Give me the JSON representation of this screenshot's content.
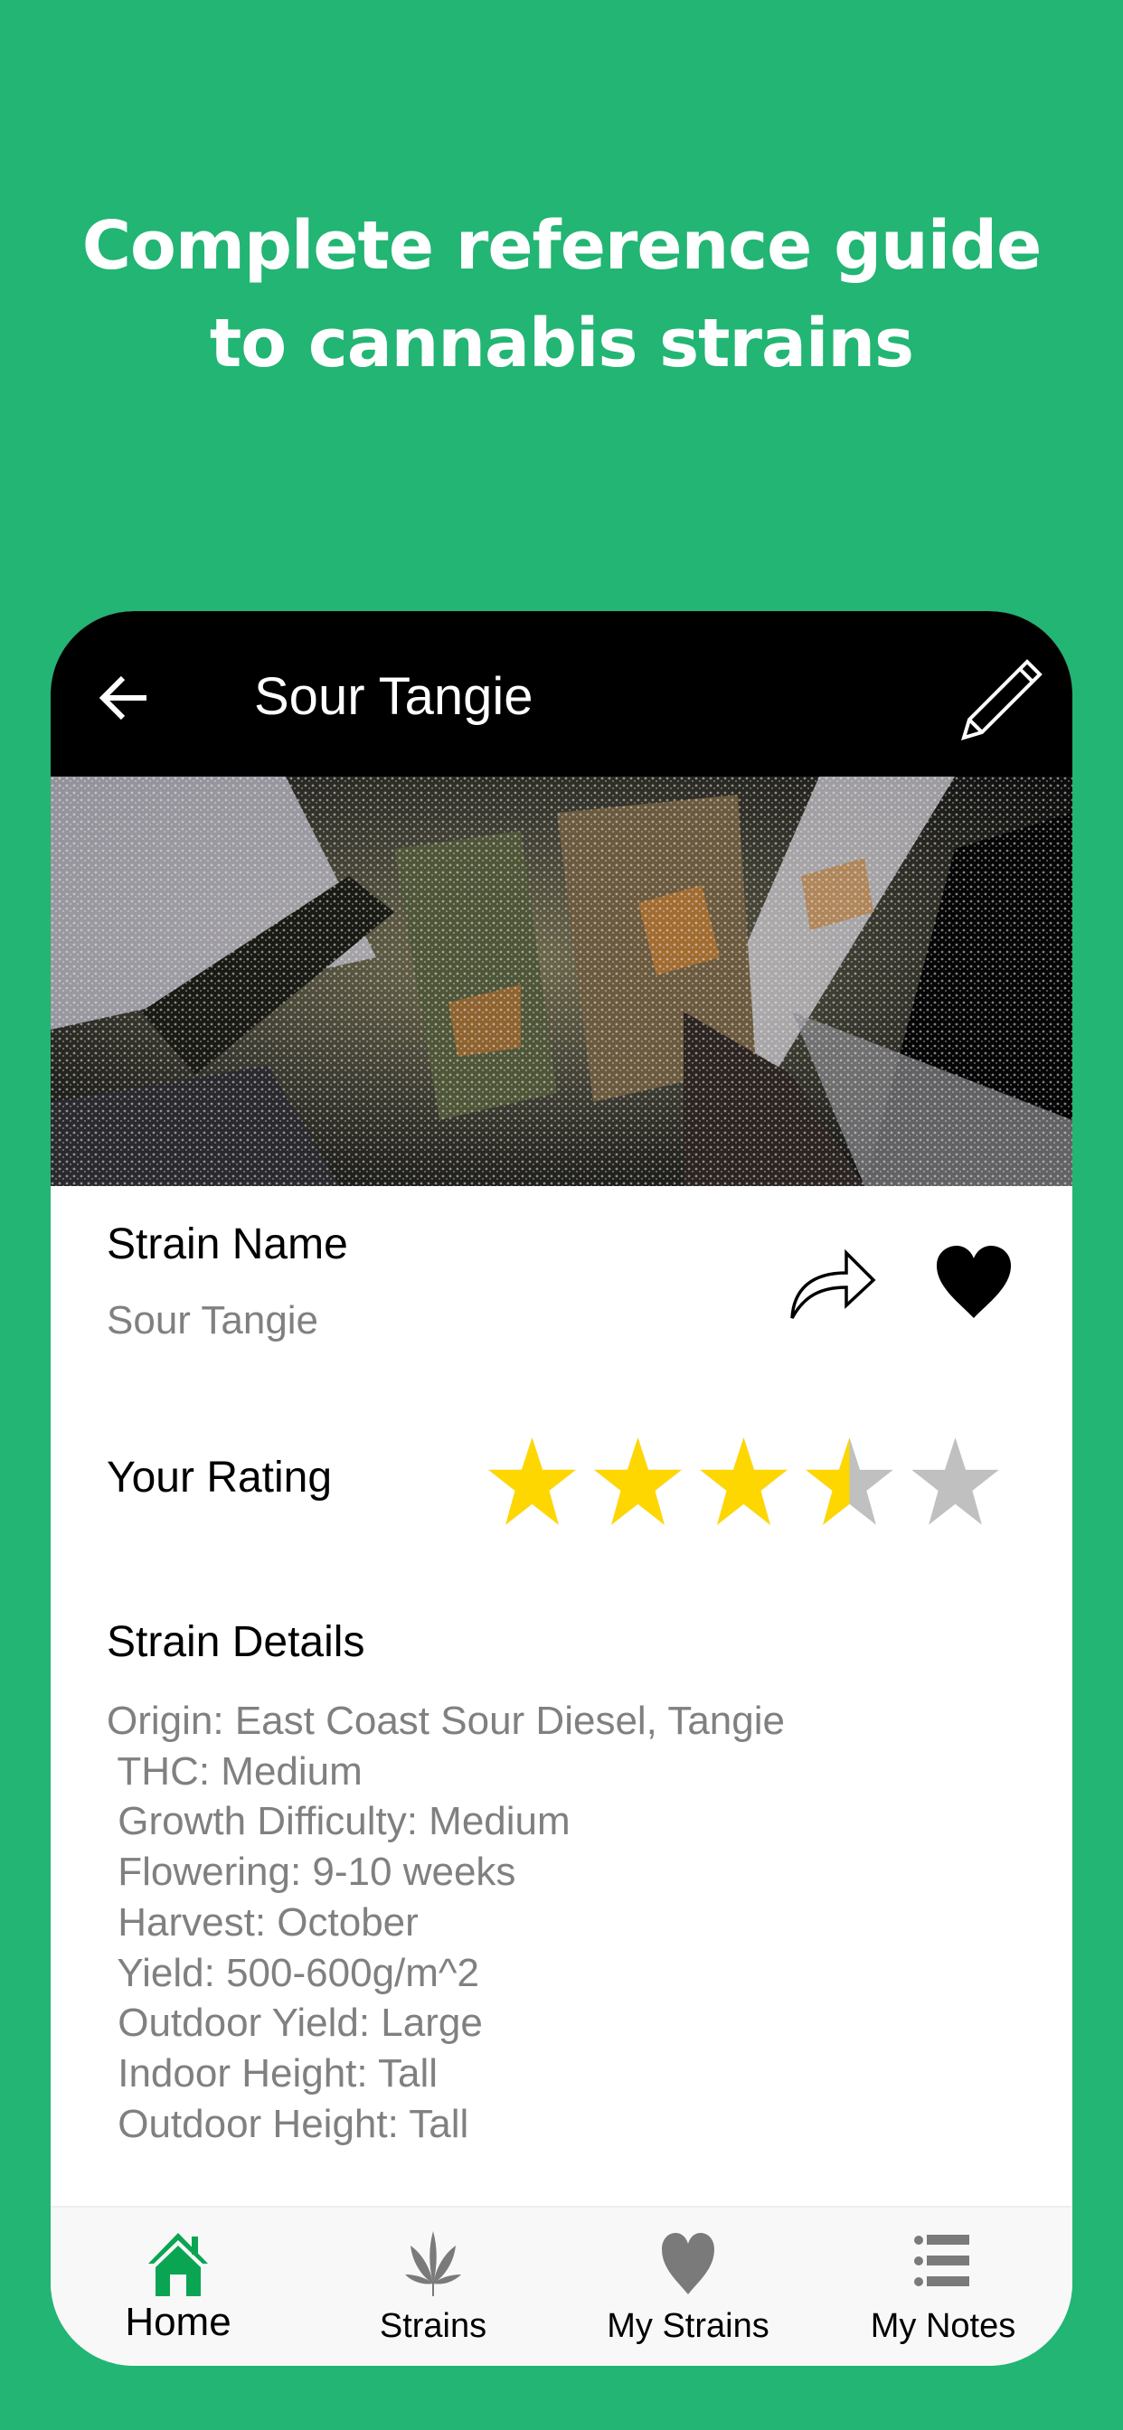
{
  "promo": {
    "line1": "Complete reference guide",
    "line2": "to cannabis strains"
  },
  "colors": {
    "background": "#22b573",
    "accent_green": "#0aa552",
    "star_filled": "#ffd700",
    "star_empty": "#c0c0c0",
    "icon_gray": "#7a7a7a"
  },
  "appbar": {
    "title": "Sour Tangie",
    "back_icon": "arrow-left-icon",
    "edit_icon": "pencil-icon"
  },
  "photo": {
    "alt": "Sour Tangie cannabis bud close-up"
  },
  "strain": {
    "name_label": "Strain Name",
    "name_value": "Sour Tangie",
    "share_icon": "share-icon",
    "favorite_icon": "heart-icon"
  },
  "rating": {
    "label": "Your Rating",
    "value": 3.5,
    "max": 5
  },
  "details": {
    "heading": "Strain Details",
    "lines": [
      "Origin: East Coast Sour Diesel, Tangie",
      " THC: Medium",
      " Growth Difficulty: Medium",
      " Flowering: 9-10 weeks",
      " Harvest: October",
      " Yield: 500-600g/m^2",
      " Outdoor Yield: Large",
      " Indoor Height: Tall",
      " Outdoor Height: Tall"
    ]
  },
  "bottom_nav": {
    "items": [
      {
        "label": "Home",
        "icon": "home-icon",
        "active": true
      },
      {
        "label": "Strains",
        "icon": "cannabis-leaf-icon",
        "active": false
      },
      {
        "label": "My Strains",
        "icon": "heart-icon",
        "active": false
      },
      {
        "label": "My Notes",
        "icon": "list-icon",
        "active": false
      }
    ]
  }
}
